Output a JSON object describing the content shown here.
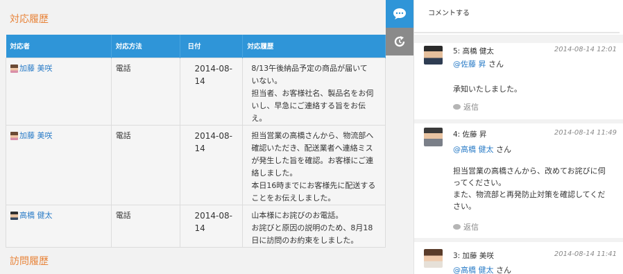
{
  "history": {
    "title": "対応履歴",
    "columns": [
      "対応者",
      "対応方法",
      "日付",
      "対応履歴"
    ],
    "rows": [
      {
        "person": "加藤 美咲",
        "method": "電話",
        "date": "2014-08-14",
        "lines": [
          "8/13午後納品予定の商品が届いて",
          "いない。",
          "担当者、お客様社名、製品名をお伺",
          "いし、早急にご連絡する旨をお伝",
          "え。"
        ]
      },
      {
        "person": "加藤 美咲",
        "method": "電話",
        "date": "2014-08-14",
        "lines": [
          "担当営業の高橋さんから、物流部へ",
          "確認いただき、配送業者へ連絡ミス",
          "が発生した旨を確認。お客様にご連",
          "絡しました。",
          "本日16時までにお客様先に配送する",
          "ことをお伝えしました。"
        ]
      },
      {
        "person": "高橋 健太",
        "method": "電話",
        "date": "2014-08-14",
        "lines": [
          "山本様にお詫びのお電話。",
          "お詫びと原因の説明のため、8月18",
          "日に訪問のお約束をしました。"
        ]
      }
    ]
  },
  "visits": {
    "title": "訪問履歴"
  },
  "comment_prompt": "コメントする",
  "comments": [
    {
      "name": "5: 高橋 健太",
      "date": "2014-08-14 12:01",
      "mention": "@佐藤 昇",
      "mention_suffix": " さん",
      "lines": [
        "承知いたしました。"
      ],
      "reply": "返信"
    },
    {
      "name": "4: 佐藤 昇",
      "date": "2014-08-14 11:49",
      "mention": "@高橋 健太",
      "mention_suffix": " さん",
      "lines": [
        "担当営業の高橋さんから、改めてお詫びに伺",
        "ってください。",
        "また、物流部と再発防止対策を確認してくだ",
        "さい。"
      ],
      "reply": "返信"
    },
    {
      "name": "3: 加藤 美咲",
      "date": "2014-08-14 11:41",
      "mention": "@高橋 健太",
      "mention_suffix": " さん",
      "lines": [],
      "reply": ""
    }
  ],
  "colors": {
    "accent": "#2f95d8",
    "section_title": "#e8843a",
    "link": "#2a7cc7"
  },
  "icons": {
    "comments_tab": "speech-bubble-icon",
    "history_tab": "refresh-icon",
    "reply": "reply-bubble-icon"
  }
}
